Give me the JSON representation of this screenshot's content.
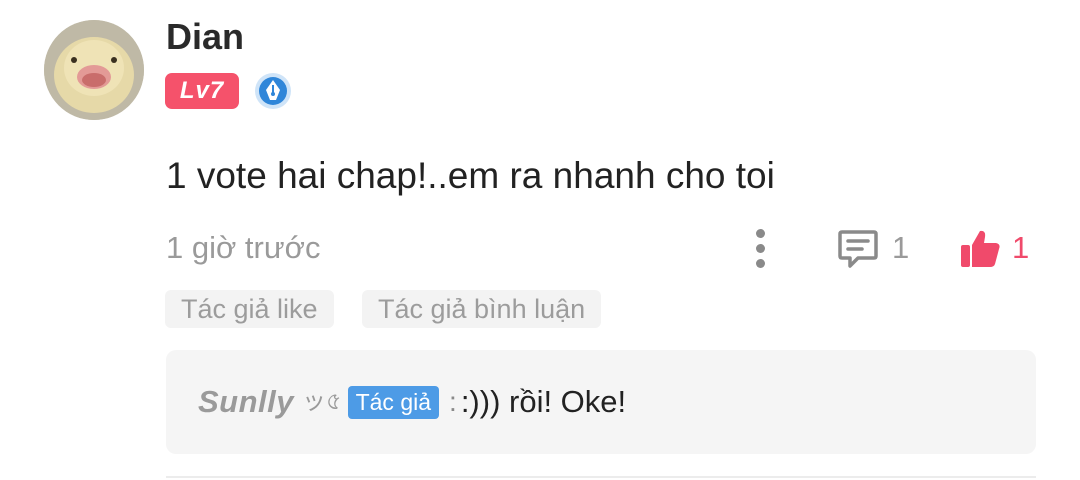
{
  "comment": {
    "author": "Dian",
    "level": "Lv7",
    "text": "1 vote hai chap!..em ra nhanh cho toi",
    "time": "1 giờ trước",
    "reply_count": "1",
    "like_count": "1",
    "tags": [
      "Tác giả like",
      "Tác giả bình luận"
    ]
  },
  "reply": {
    "author": "Sunlly",
    "decor": "ッ৫",
    "author_tag": "Tác giả",
    "separator": ":",
    "text": ":))) rồi! Oke!"
  },
  "colors": {
    "level_badge": "#f5526b",
    "like": "#f04a6b",
    "author_tag": "#4d9be6",
    "pen_badge": "#2f86d9"
  },
  "icons": {
    "more": "vertical-dots-icon",
    "reply": "comment-bubble-icon",
    "like": "thumbs-up-icon",
    "badge": "pen-nib-badge-icon"
  }
}
